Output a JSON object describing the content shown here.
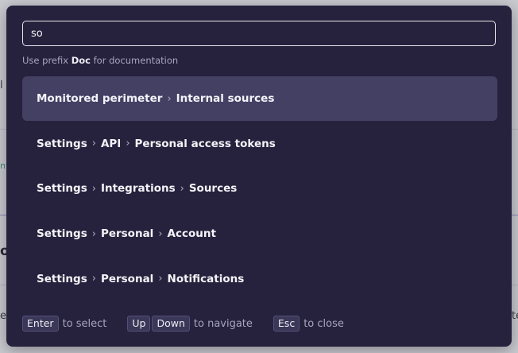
{
  "background": {
    "fragments": [
      "l k",
      "nt",
      "or",
      "ec",
      "te"
    ]
  },
  "palette": {
    "search": {
      "value": "so",
      "placeholder": ""
    },
    "hint": {
      "prefix_text": "Use prefix",
      "prefix_keyword": "Doc",
      "suffix_text": "for documentation"
    },
    "results": [
      {
        "parts": [
          "Monitored perimeter",
          "Internal sources"
        ],
        "selected": true
      },
      {
        "parts": [
          "Settings",
          "API",
          "Personal access tokens"
        ],
        "selected": false
      },
      {
        "parts": [
          "Settings",
          "Integrations",
          "Sources"
        ],
        "selected": false
      },
      {
        "parts": [
          "Settings",
          "Personal",
          "Account"
        ],
        "selected": false
      },
      {
        "parts": [
          "Settings",
          "Personal",
          "Notifications"
        ],
        "selected": false
      }
    ],
    "separator_icon": "chevron-right-icon",
    "footer": {
      "select_key": "Enter",
      "select_text": "to select",
      "nav_key_up": "Up",
      "nav_key_down": "Down",
      "nav_text": "to navigate",
      "close_key": "Esc",
      "close_text": "to close"
    }
  },
  "colors": {
    "palette_bg": "#26223d",
    "selected_row_bg": "#444064",
    "text_primary": "#f4f3f8",
    "text_muted": "#a8a5bd"
  }
}
